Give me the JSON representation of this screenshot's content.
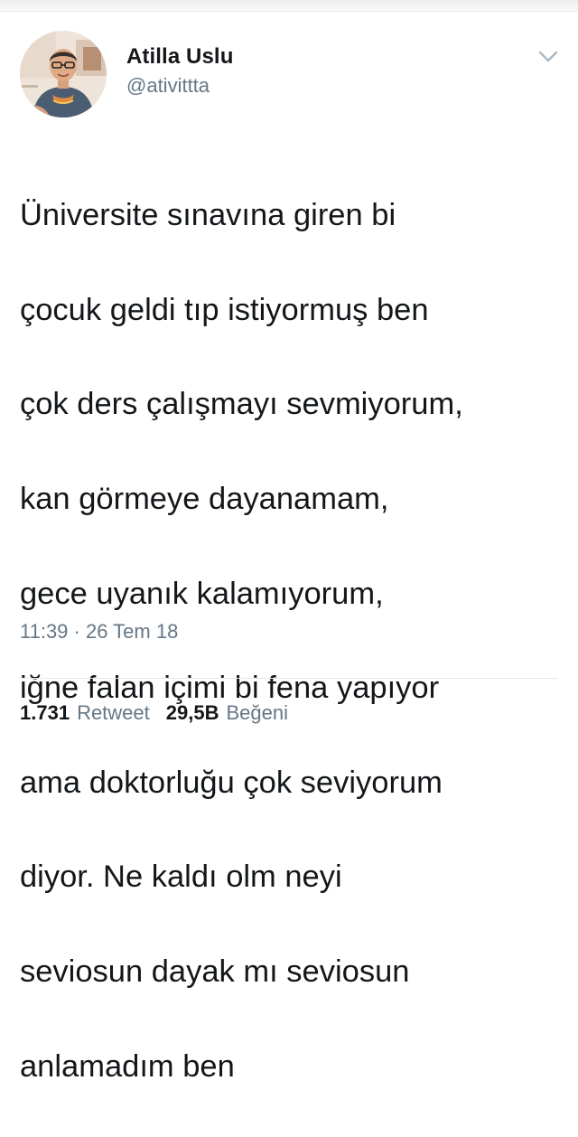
{
  "tweet": {
    "display_name": "Atilla Uslu",
    "handle": "@ativittta",
    "text_lines": [
      "Üniversite sınavına giren bi",
      "çocuk geldi tıp istiyormuş ben",
      "çok ders çalışmayı sevmiyorum,",
      "kan görmeye dayanamam,",
      "gece uyanık kalamıyorum,",
      "iğne falan içimi bi fena yapıyor",
      "ama doktorluğu çok seviyorum",
      "diyor. Ne kaldı olm neyi",
      "seviosun dayak mı seviosun",
      "anlamadım ben"
    ],
    "time": "11:39",
    "separator": " · ",
    "date": "26 Tem 18",
    "retweet_count": "1.731",
    "retweet_label": "Retweet",
    "like_count": "29,5B",
    "like_label": "Beğeni"
  },
  "icons": {
    "menu": "chevron-down-icon",
    "avatar": "profile-photo"
  },
  "colors": {
    "text_primary": "#14171a",
    "text_secondary": "#657786",
    "divider": "#e1e8ed"
  }
}
